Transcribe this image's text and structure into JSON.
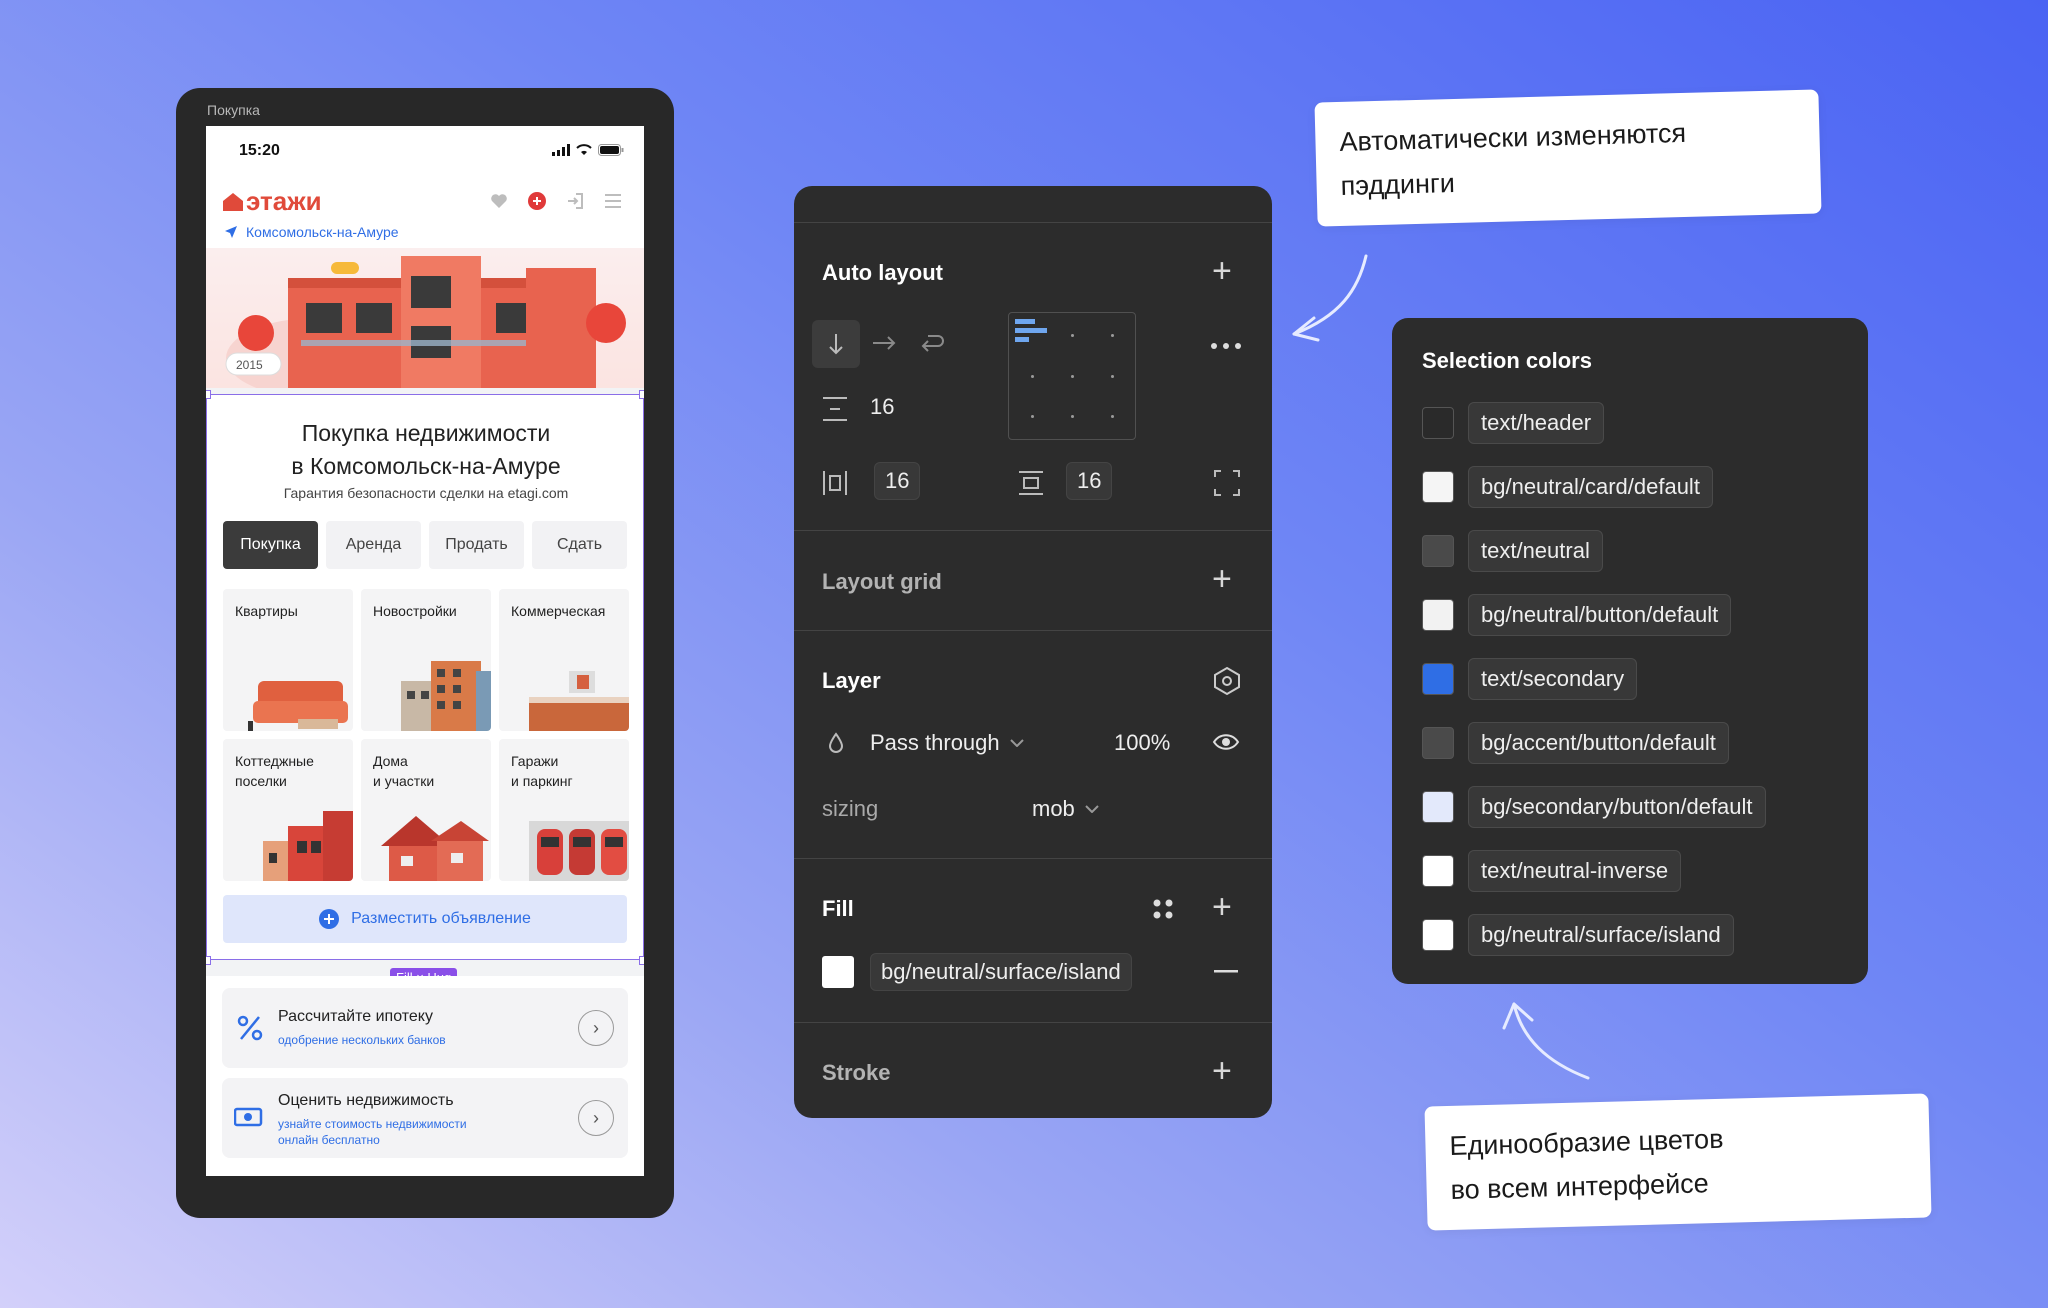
{
  "frame": {
    "label": "Покупка"
  },
  "phone": {
    "time": "15:20",
    "brand": "этажи",
    "city": "Комсомольск-на-Амуре",
    "hero_badge_year": "2015",
    "title_line1": "Покупка недвижимости",
    "title_line2": "в Комсомольск-на-Амуре",
    "subtitle": "Гарантия безопасности сделки на etagi.com",
    "tabs": [
      {
        "label": "Покупка",
        "active": true
      },
      {
        "label": "Аренда",
        "active": false
      },
      {
        "label": "Продать",
        "active": false
      },
      {
        "label": "Сдать",
        "active": false
      }
    ],
    "categories": [
      {
        "label": "Квартиры",
        "icon": "sofa-icon"
      },
      {
        "label": "Новостройки",
        "icon": "building-icon"
      },
      {
        "label": "Коммерческая",
        "icon": "office-icon"
      },
      {
        "label": "Коттеджные\nпоселки",
        "icon": "cottage-icon"
      },
      {
        "label": "Дома\nи участки",
        "icon": "house-icon"
      },
      {
        "label": "Гаражи\nи паркинг",
        "icon": "car-icon"
      }
    ],
    "post_button": "Разместить объявление",
    "fill_hug": "Fill × Hug",
    "mortgage": {
      "title": "Рассчитайте ипотеку",
      "subtitle": "одобрение нескольких банков"
    },
    "valuation": {
      "title": "Оценить недвижимость",
      "subtitle": "узнайте стоимость недвижимости\nонлайн бесплатно"
    }
  },
  "panel": {
    "auto_layout": {
      "title": "Auto layout",
      "gap": "16",
      "padding_h": "16",
      "padding_v": "16"
    },
    "layout_grid": {
      "title": "Layout grid"
    },
    "layer": {
      "title": "Layer",
      "blend": "Pass through",
      "opacity": "100%",
      "sizing_label": "sizing",
      "sizing_value": "mob"
    },
    "fill": {
      "title": "Fill",
      "style": "bg/neutral/surface/island"
    },
    "stroke": {
      "title": "Stroke"
    }
  },
  "selection_colors": {
    "title": "Selection colors",
    "items": [
      {
        "name": "text/header",
        "color": "#2a2a2a"
      },
      {
        "name": "bg/neutral/card/default",
        "color": "#f5f5f5"
      },
      {
        "name": "text/neutral",
        "color": "#4a4a4a"
      },
      {
        "name": "bg/neutral/button/default",
        "color": "#f2f2f2"
      },
      {
        "name": "text/secondary",
        "color": "#2f6ee5"
      },
      {
        "name": "bg/accent/button/default",
        "color": "#4a4a4a"
      },
      {
        "name": "bg/secondary/button/default",
        "color": "#e3e9fb"
      },
      {
        "name": "text/neutral-inverse",
        "color": "#ffffff"
      },
      {
        "name": "bg/neutral/surface/island",
        "color": "#ffffff"
      }
    ]
  },
  "notes": {
    "paddings": "Автоматически изменяются\nпэддинги",
    "colors": "Единообразие цветов\nво всем интерфейсе"
  }
}
